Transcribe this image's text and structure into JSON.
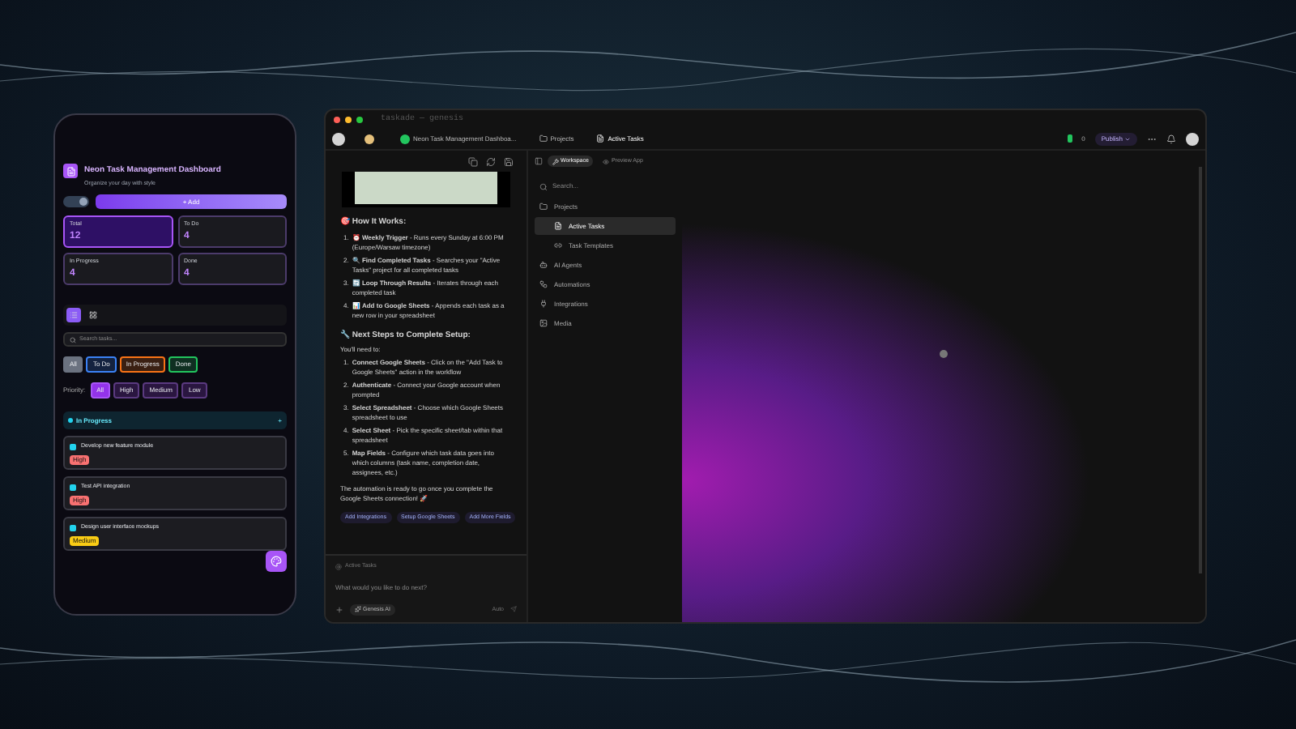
{
  "phone": {
    "title": "Neon Task Management Dashboard",
    "subtitle": "Organize your day with style",
    "add_button": "+ Add",
    "theme_toggle": {
      "on": true
    },
    "stats": [
      {
        "label": "Total",
        "value": "12",
        "selected": true
      },
      {
        "label": "To Do",
        "value": "4",
        "selected": false
      },
      {
        "label": "In Progress",
        "value": "4",
        "selected": false
      },
      {
        "label": "Done",
        "value": "4",
        "selected": false
      }
    ],
    "views": [
      {
        "kind": "list",
        "selected": true
      },
      {
        "kind": "grid",
        "selected": false
      }
    ],
    "search": {
      "placeholder": "Search tasks..."
    },
    "status_filters": [
      {
        "label": "All",
        "selected": true,
        "color": "#6b7280"
      },
      {
        "label": "To Do",
        "selected": false,
        "color": "#3b82f6"
      },
      {
        "label": "In Progress",
        "selected": false,
        "color": "#f97316"
      },
      {
        "label": "Done",
        "selected": false,
        "color": "#22c55e"
      }
    ],
    "priority_label": "Priority:",
    "priority_filters": [
      {
        "label": "All",
        "selected": true
      },
      {
        "label": "High",
        "selected": false
      },
      {
        "label": "Medium",
        "selected": false
      },
      {
        "label": "Low",
        "selected": false
      }
    ],
    "section": {
      "title": "In Progress",
      "action": "+"
    },
    "tasks": [
      {
        "title": "Develop new feature module",
        "priority": "High",
        "color": "#f87171"
      },
      {
        "title": "Test API integration",
        "priority": "High",
        "color": "#f87171"
      },
      {
        "title": "Design user interface mockups",
        "priority": "Medium",
        "color": "#facc15"
      }
    ]
  },
  "window": {
    "title": "taskade — genesis",
    "breadcrumbs": [
      {
        "label": "Neon Task Management Dashboa...",
        "kind": "app"
      },
      {
        "label": "Projects",
        "kind": "folder"
      },
      {
        "label": "Active Tasks",
        "kind": "doc"
      }
    ],
    "count": "0",
    "publish": "Publish",
    "toolbar": [
      {
        "label": "Workspace",
        "selected": true
      },
      {
        "label": "Preview App",
        "selected": false
      }
    ]
  },
  "chat": {
    "how_heading": {
      "icon": "🎯",
      "text": "How It Works:"
    },
    "how_items": [
      {
        "number": "1.",
        "icon": "⏰",
        "text": "**Weekly Trigger** - Runs every Sunday at 6:00 PM (Europe/Warsaw timezone)"
      },
      {
        "number": "2.",
        "icon": "🔍",
        "text": "**Find Completed Tasks** - Searches your \"Active Tasks\" project for all completed tasks"
      },
      {
        "number": "3.",
        "icon": "🔄",
        "text": "**Loop Through Results** - Iterates through each completed task"
      },
      {
        "number": "4.",
        "icon": "📊",
        "text": "**Add to Google Sheets** - Appends each task as a new row in your spreadsheet"
      }
    ],
    "next_heading": {
      "icon": "🔧",
      "text": "Next Steps to Complete Setup:"
    },
    "intro": "You'll need to:",
    "steps": [
      {
        "number": "1.",
        "text": "**Connect Google Sheets** - Click on the \"Add Task to Google Sheets\" action in the workflow"
      },
      {
        "number": "2.",
        "text": "**Authenticate** - Connect your Google account when prompted"
      },
      {
        "number": "3.",
        "text": "**Select Spreadsheet** - Choose which Google Sheets spreadsheet to use"
      },
      {
        "number": "4.",
        "text": "**Select Sheet** - Pick the specific sheet/tab within that spreadsheet"
      },
      {
        "number": "5.",
        "text": "**Map Fields** - Configure which task data goes into which columns (task name, completion date, assignees, etc.)"
      }
    ],
    "closing": "The automation is ready to go once you complete the Google Sheets connection! 🚀",
    "suggestions": [
      "Add Integrations",
      "Setup Google Sheets",
      "Add More Fields"
    ],
    "context": "Active Tasks",
    "placeholder": "What would you like to do next?",
    "agent": "Genesis AI",
    "mode": "Auto"
  },
  "sidebar": {
    "search": {
      "placeholder": "Search..."
    },
    "items": [
      {
        "label": "Projects",
        "kind": "folder",
        "selected": false,
        "children": [
          {
            "label": "Active Tasks",
            "kind": "doc",
            "selected": true
          },
          {
            "label": "Task Templates",
            "kind": "link",
            "selected": false
          }
        ]
      },
      {
        "label": "AI Agents",
        "kind": "bot",
        "selected": false
      },
      {
        "label": "Automations",
        "kind": "flow",
        "selected": false
      },
      {
        "label": "Integrations",
        "kind": "plug",
        "selected": false
      },
      {
        "label": "Media",
        "kind": "image",
        "selected": false
      }
    ]
  }
}
